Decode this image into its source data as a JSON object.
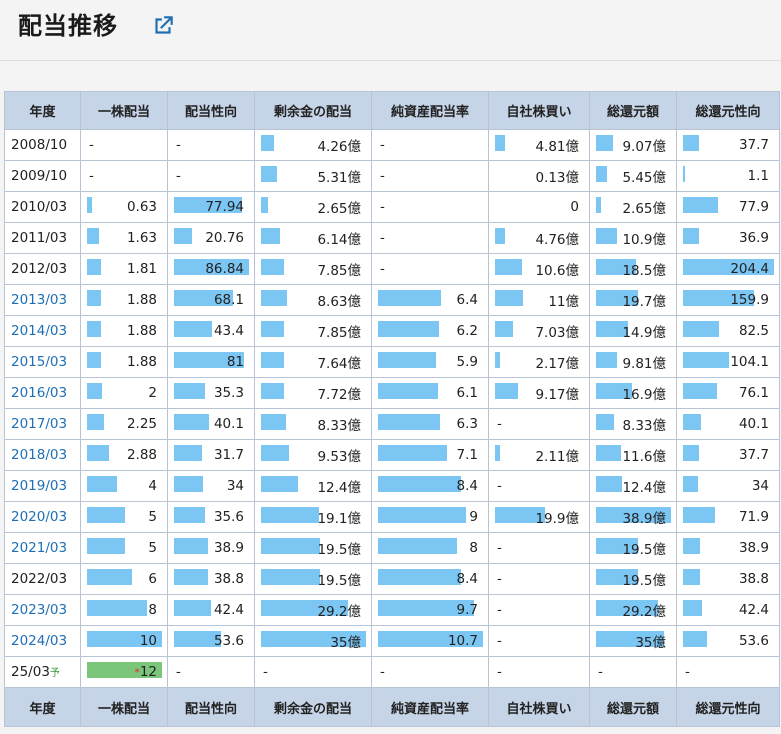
{
  "page": {
    "title": "配当推移",
    "link_icon": "external-link-icon",
    "accent": "#1f6fb5",
    "bar_color": "#7cc6f4",
    "forecast_bar_color": "#7cc67c"
  },
  "headers": [
    "年度",
    "一株配当",
    "配当性向",
    "剰余金の配当",
    "純資産配当率",
    "自社株買い",
    "総還元額",
    "総還元性向"
  ],
  "rows": [
    {
      "year": "2008/10",
      "link": false,
      "cells": [
        {
          "t": "-"
        },
        {
          "t": "-"
        },
        {
          "t": "4.26億",
          "b": 0.12
        },
        {
          "t": "-"
        },
        {
          "t": "4.81億",
          "b": 0.11
        },
        {
          "t": "9.07億",
          "b": 0.23
        },
        {
          "t": "37.7",
          "b": 0.18
        }
      ]
    },
    {
      "year": "2009/10",
      "link": false,
      "cells": [
        {
          "t": "-"
        },
        {
          "t": "-"
        },
        {
          "t": "5.31億",
          "b": 0.15
        },
        {
          "t": "-"
        },
        {
          "t": "0.13億",
          "b": 0
        },
        {
          "t": "5.45億",
          "b": 0.14
        },
        {
          "t": "1.1",
          "b": 0.01
        }
      ]
    },
    {
      "year": "2010/03",
      "link": false,
      "cells": [
        {
          "t": "0.63",
          "b": 0.06
        },
        {
          "t": "77.94",
          "b": 0.9
        },
        {
          "t": "2.65億",
          "b": 0.07
        },
        {
          "t": "-"
        },
        {
          "t": "0",
          "b": 0
        },
        {
          "t": "2.65億",
          "b": 0.07
        },
        {
          "t": "77.9",
          "b": 0.38
        }
      ]
    },
    {
      "year": "2011/03",
      "link": false,
      "cells": [
        {
          "t": "1.63",
          "b": 0.16
        },
        {
          "t": "20.76",
          "b": 0.24
        },
        {
          "t": "6.14億",
          "b": 0.18
        },
        {
          "t": "-"
        },
        {
          "t": "4.76億",
          "b": 0.11
        },
        {
          "t": "10.9億",
          "b": 0.28
        },
        {
          "t": "36.9",
          "b": 0.18
        }
      ]
    },
    {
      "year": "2012/03",
      "link": false,
      "cells": [
        {
          "t": "1.81",
          "b": 0.18
        },
        {
          "t": "86.84",
          "b": 1.0
        },
        {
          "t": "7.85億",
          "b": 0.22
        },
        {
          "t": "-"
        },
        {
          "t": "10.6億",
          "b": 0.3
        },
        {
          "t": "18.5億",
          "b": 0.53
        },
        {
          "t": "204.4",
          "b": 1.0
        }
      ]
    },
    {
      "year": "2013/03",
      "link": true,
      "cells": [
        {
          "t": "1.88",
          "b": 0.19
        },
        {
          "t": "68.1",
          "b": 0.78
        },
        {
          "t": "8.63億",
          "b": 0.25
        },
        {
          "t": "6.4",
          "b": 0.6
        },
        {
          "t": "11億",
          "b": 0.31
        },
        {
          "t": "19.7億",
          "b": 0.56
        },
        {
          "t": "159.9",
          "b": 0.78
        }
      ]
    },
    {
      "year": "2014/03",
      "link": true,
      "cells": [
        {
          "t": "1.88",
          "b": 0.19
        },
        {
          "t": "43.4",
          "b": 0.5
        },
        {
          "t": "7.85億",
          "b": 0.22
        },
        {
          "t": "6.2",
          "b": 0.58
        },
        {
          "t": "7.03億",
          "b": 0.2
        },
        {
          "t": "14.9億",
          "b": 0.43
        },
        {
          "t": "82.5",
          "b": 0.4
        }
      ]
    },
    {
      "year": "2015/03",
      "link": true,
      "cells": [
        {
          "t": "1.88",
          "b": 0.19
        },
        {
          "t": "81",
          "b": 0.93
        },
        {
          "t": "7.64億",
          "b": 0.22
        },
        {
          "t": "5.9",
          "b": 0.55
        },
        {
          "t": "2.17億",
          "b": 0.06
        },
        {
          "t": "9.81億",
          "b": 0.28
        },
        {
          "t": "104.1",
          "b": 0.51
        }
      ]
    },
    {
      "year": "2016/03",
      "link": true,
      "cells": [
        {
          "t": "2",
          "b": 0.2
        },
        {
          "t": "35.3",
          "b": 0.41
        },
        {
          "t": "7.72億",
          "b": 0.22
        },
        {
          "t": "6.1",
          "b": 0.57
        },
        {
          "t": "9.17億",
          "b": 0.26
        },
        {
          "t": "16.9億",
          "b": 0.48
        },
        {
          "t": "76.1",
          "b": 0.37
        }
      ]
    },
    {
      "year": "2017/03",
      "link": true,
      "cells": [
        {
          "t": "2.25",
          "b": 0.23
        },
        {
          "t": "40.1",
          "b": 0.46
        },
        {
          "t": "8.33億",
          "b": 0.24
        },
        {
          "t": "6.3",
          "b": 0.59
        },
        {
          "t": "-"
        },
        {
          "t": "8.33億",
          "b": 0.24
        },
        {
          "t": "40.1",
          "b": 0.2
        }
      ]
    },
    {
      "year": "2018/03",
      "link": true,
      "cells": [
        {
          "t": "2.88",
          "b": 0.29
        },
        {
          "t": "31.7",
          "b": 0.37
        },
        {
          "t": "9.53億",
          "b": 0.27
        },
        {
          "t": "7.1",
          "b": 0.66
        },
        {
          "t": "2.11億",
          "b": 0.06
        },
        {
          "t": "11.6億",
          "b": 0.33
        },
        {
          "t": "37.7",
          "b": 0.18
        }
      ]
    },
    {
      "year": "2019/03",
      "link": true,
      "cells": [
        {
          "t": "4",
          "b": 0.4
        },
        {
          "t": "34",
          "b": 0.39
        },
        {
          "t": "12.4億",
          "b": 0.35
        },
        {
          "t": "8.4",
          "b": 0.79
        },
        {
          "t": "-"
        },
        {
          "t": "12.4億",
          "b": 0.35
        },
        {
          "t": "34",
          "b": 0.17
        }
      ]
    },
    {
      "year": "2020/03",
      "link": true,
      "cells": [
        {
          "t": "5",
          "b": 0.5
        },
        {
          "t": "35.6",
          "b": 0.41
        },
        {
          "t": "19.1億",
          "b": 0.55
        },
        {
          "t": "9",
          "b": 0.84
        },
        {
          "t": "19.9億",
          "b": 0.56
        },
        {
          "t": "38.9億",
          "b": 1.0
        },
        {
          "t": "71.9",
          "b": 0.35
        }
      ]
    },
    {
      "year": "2021/03",
      "link": true,
      "cells": [
        {
          "t": "5",
          "b": 0.5
        },
        {
          "t": "38.9",
          "b": 0.45
        },
        {
          "t": "19.5億",
          "b": 0.56
        },
        {
          "t": "8",
          "b": 0.75
        },
        {
          "t": "-"
        },
        {
          "t": "19.5億",
          "b": 0.56
        },
        {
          "t": "38.9",
          "b": 0.19
        }
      ]
    },
    {
      "year": "2022/03",
      "link": false,
      "cells": [
        {
          "t": "6",
          "b": 0.6
        },
        {
          "t": "38.8",
          "b": 0.45
        },
        {
          "t": "19.5億",
          "b": 0.56
        },
        {
          "t": "8.4",
          "b": 0.79
        },
        {
          "t": "-"
        },
        {
          "t": "19.5億",
          "b": 0.56
        },
        {
          "t": "38.8",
          "b": 0.19
        }
      ]
    },
    {
      "year": "2023/03",
      "link": true,
      "cells": [
        {
          "t": "8",
          "b": 0.8
        },
        {
          "t": "42.4",
          "b": 0.49
        },
        {
          "t": "29.2億",
          "b": 0.83
        },
        {
          "t": "9.7",
          "b": 0.91
        },
        {
          "t": "-"
        },
        {
          "t": "29.2億",
          "b": 0.83
        },
        {
          "t": "42.4",
          "b": 0.21
        }
      ]
    },
    {
      "year": "2024/03",
      "link": true,
      "cells": [
        {
          "t": "10",
          "b": 1.0
        },
        {
          "t": "53.6",
          "b": 0.62
        },
        {
          "t": "35億",
          "b": 1.0
        },
        {
          "t": "10.7",
          "b": 1.0
        },
        {
          "t": "-"
        },
        {
          "t": "35億",
          "b": 0.9
        },
        {
          "t": "53.6",
          "b": 0.26
        }
      ]
    },
    {
      "year": "25/03",
      "yo": "予",
      "link": false,
      "forecast": true,
      "cells": [
        {
          "t": "12",
          "ast": "*",
          "b": 1.0,
          "green": true
        },
        {
          "t": "-"
        },
        {
          "t": "-"
        },
        {
          "t": "-"
        },
        {
          "t": "-"
        },
        {
          "t": "-"
        },
        {
          "t": "-"
        }
      ]
    }
  ]
}
